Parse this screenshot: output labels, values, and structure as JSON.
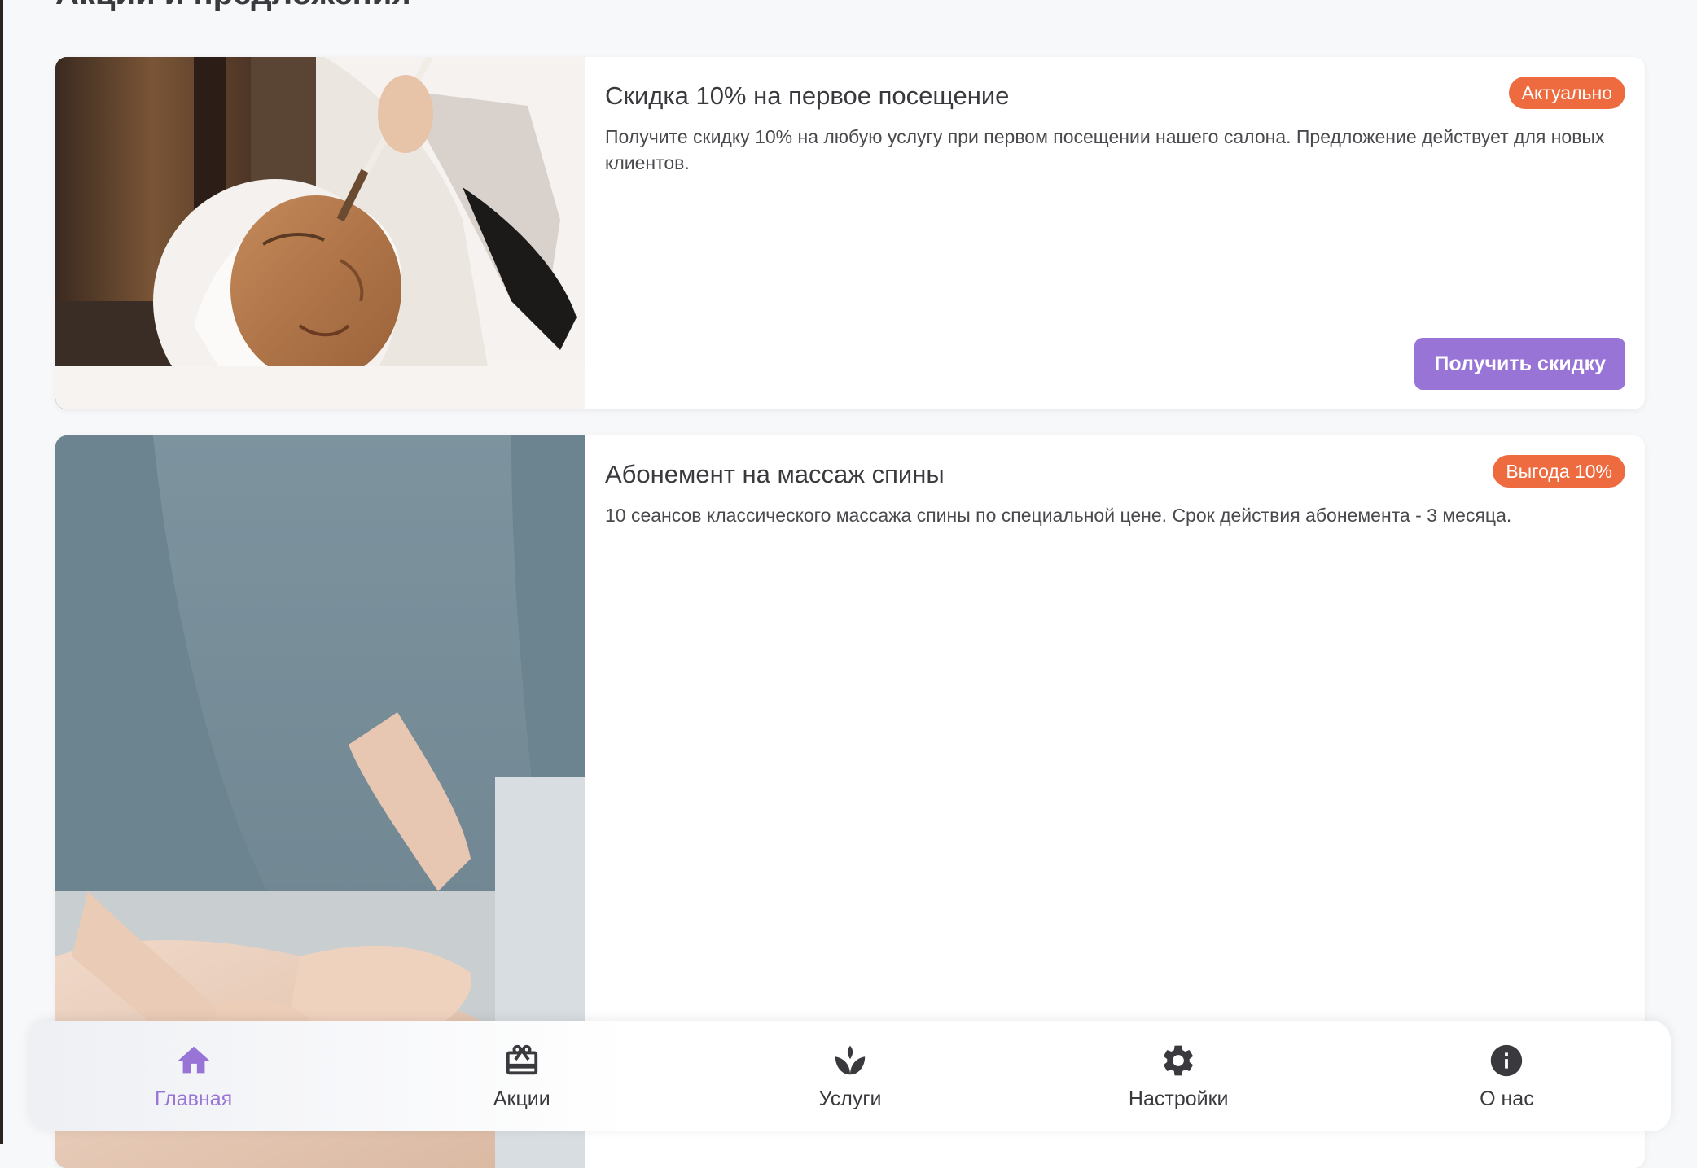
{
  "page": {
    "title": "Акции и предложения"
  },
  "promotions": [
    {
      "title": "Скидка 10% на первое посещение",
      "description": "Получите скидку 10% на любую услугу при первом посещении нашего салона. Предложение действует для новых клиентов.",
      "badge": "Актуально",
      "button_label": "Получить скидку",
      "image_icon": "facial-mask-photo"
    },
    {
      "title": "Абонемент на массаж спины",
      "description": "10 сеансов классического массажа спины по специальной цене. Срок действия абонемента - 3 месяца.",
      "badge": "Выгода 10%",
      "image_icon": "back-massage-photo"
    }
  ],
  "nav": {
    "active": "home",
    "items": [
      {
        "id": "home",
        "label": "Главная",
        "icon": "home-icon"
      },
      {
        "id": "promotions",
        "label": "Акции",
        "icon": "gift-icon"
      },
      {
        "id": "services",
        "label": "Услуги",
        "icon": "spa-icon"
      },
      {
        "id": "settings",
        "label": "Настройки",
        "icon": "gear-icon"
      },
      {
        "id": "about",
        "label": "О нас",
        "icon": "info-icon"
      }
    ]
  },
  "colors": {
    "accent": "#9774d6",
    "badge": "#ee6b3f",
    "background": "#f7f8fa",
    "card": "#ffffff"
  }
}
